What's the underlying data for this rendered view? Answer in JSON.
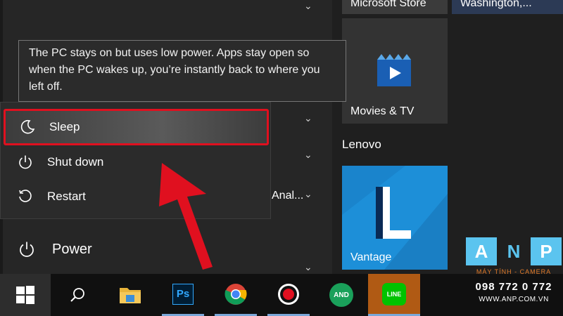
{
  "start_menu": {
    "app_list_fragment": "Anal...",
    "tooltip": "The PC stays on but uses low power. Apps stay open so when the PC wakes up, you’re instantly back to where you left off.",
    "power_options": [
      {
        "label": "Sleep",
        "icon": "moon-icon",
        "highlighted": true
      },
      {
        "label": "Shut down",
        "icon": "power-icon"
      },
      {
        "label": "Restart",
        "icon": "restart-icon"
      }
    ],
    "power_label": "Power"
  },
  "tiles": {
    "top_left": "Microsoft Store",
    "top_right": "Washington,...",
    "movies": "Movies & TV",
    "group_lenovo": "Lenovo",
    "vantage": "Vantage"
  },
  "taskbar": {
    "items": [
      "windows-start-icon",
      "search-icon",
      "file-explorer-icon",
      "photoshop-icon",
      "chrome-icon",
      "record-icon",
      "anydesk-icon",
      "line-icon"
    ],
    "ps_text": "Ps",
    "line_text": "LINE",
    "and_text": "AND"
  },
  "watermark": {
    "letters": [
      "A",
      "N",
      "P"
    ],
    "tagline": "MÁY TÍNH - CAMERA",
    "phone": "098 772 0 772",
    "site": "WWW.ANP.COM.VN"
  },
  "colors": {
    "highlight_border": "#e0101f",
    "arrow": "#e0101f",
    "movies_tile": "#2f2f2f",
    "vantage_tile": "#1d8fd8"
  }
}
